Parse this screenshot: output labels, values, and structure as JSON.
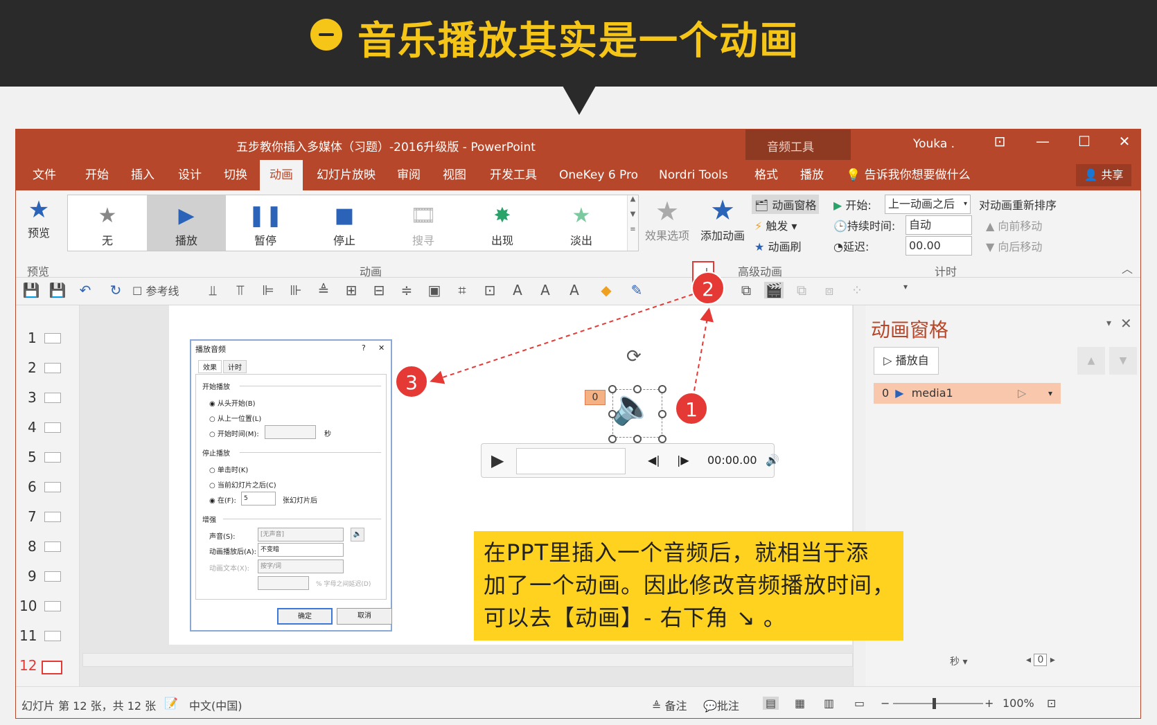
{
  "banner": {
    "title": "音乐播放其实是一个动画"
  },
  "window": {
    "title": "五步教你插入多媒体（习题）-2016升级版 - PowerPoint",
    "context_title": "音频工具",
    "user": "Youka .",
    "min": "—",
    "restore": "☐",
    "close": "✕"
  },
  "tabs": [
    "文件",
    "开始",
    "插入",
    "设计",
    "切换",
    "动画",
    "幻灯片放映",
    "审阅",
    "视图",
    "开发工具",
    "OneKey 6 Pro",
    "Nordri Tools",
    "格式",
    "播放",
    "告诉我你想要做什么"
  ],
  "share": "共享",
  "ribbon": {
    "preview": "预览",
    "gallery": [
      "无",
      "播放",
      "暂停",
      "停止",
      "搜寻",
      "出现",
      "淡出"
    ],
    "effect_options": "效果选项",
    "add_animation": "添加动画",
    "anim_pane": "动画窗格",
    "trigger": "触发",
    "painter": "动画刷",
    "start_label": "开始:",
    "start_value": "上一动画之后",
    "duration_label": "持续时间:",
    "duration_value": "自动",
    "delay_label": "延迟:",
    "delay_value": "00.00",
    "reorder": "对动画重新排序",
    "move_earlier": "向前移动",
    "move_later": "向后移动",
    "groups": {
      "preview": "预览",
      "animation": "动画",
      "advanced": "高级动画",
      "timing": "计时"
    }
  },
  "qat": {
    "guides": "参考线"
  },
  "slides": [
    "1",
    "2",
    "3",
    "4",
    "5",
    "6",
    "7",
    "8",
    "9",
    "10",
    "11",
    "12"
  ],
  "dialog": {
    "title": "播放音频",
    "help": "?",
    "close": "✕",
    "tab_effect": "效果",
    "tab_timing": "计时",
    "start_section": "开始播放",
    "opt_begin": "从头开始(B)",
    "opt_last": "从上一位置(L)",
    "opt_time": "开始时间(M):",
    "seconds": "秒",
    "stop_section": "停止播放",
    "opt_click": "单击时(K)",
    "opt_after_slide": "当前幻灯片之后(C)",
    "opt_after": "在(F):",
    "after_value": "5",
    "after_suffix": "张幻灯片后",
    "enhance_section": "增强",
    "sound_label": "声音(S):",
    "sound_value": "[无声音]",
    "after_anim_label": "动画播放后(A):",
    "after_anim_value": "不变暗",
    "anim_text_label": "动画文本(X):",
    "anim_text_value": "按字/词",
    "delay_note": "% 字母之间延迟(D)",
    "ok": "确定",
    "cancel": "取消"
  },
  "player": {
    "time": "00:00.00"
  },
  "anim_tag": "0",
  "note": {
    "line1": "在PPT里插入一个音频后，就相当于添",
    "line2": "加了一个动画。因此修改音频播放时间，",
    "line3": "可以去【动画】- 右下角  ↘  。"
  },
  "badges": [
    "1",
    "2",
    "3"
  ],
  "pane": {
    "title": "动画窗格",
    "play_from": "播放自",
    "item_num": "0",
    "item_name": "media1",
    "seconds": "秒",
    "zoom_box": "0"
  },
  "status": {
    "slide_info": "幻灯片 第 12 张，共 12 张",
    "language": "中文(中国)",
    "notes": "备注",
    "comments": "批注",
    "zoom": "100%"
  }
}
